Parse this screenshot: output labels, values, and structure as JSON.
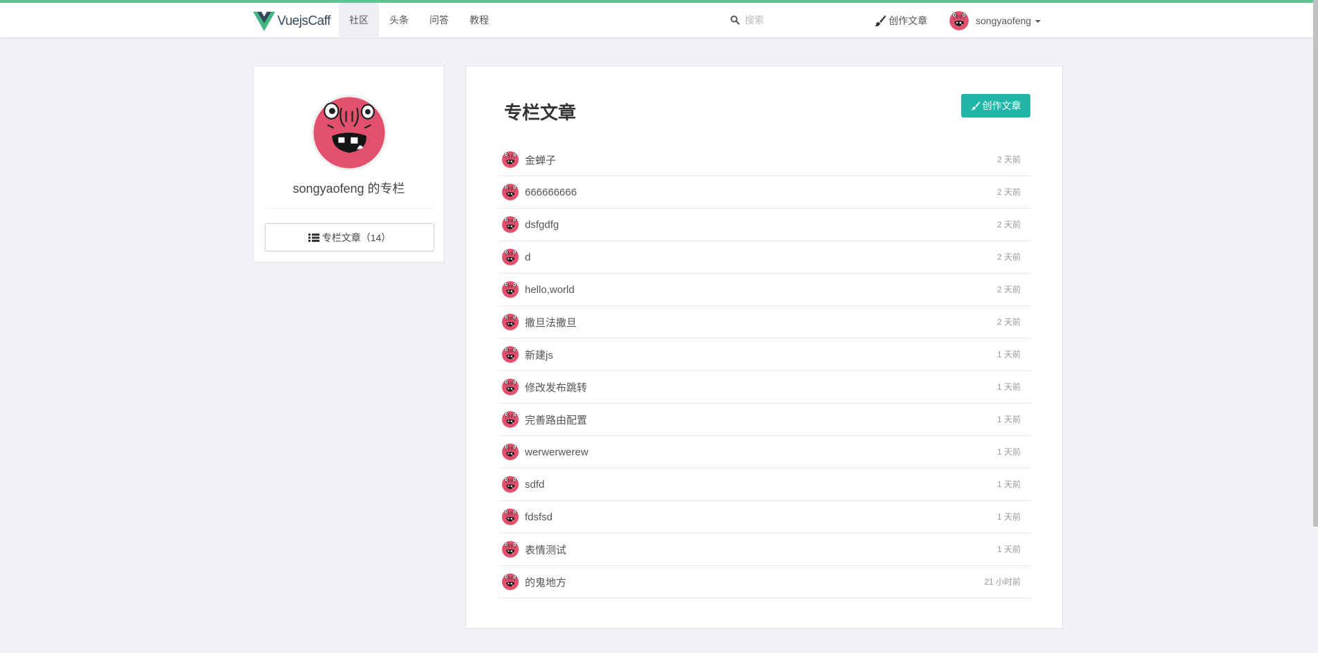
{
  "brand": {
    "name": "VuejsCaff",
    "logo_colors": {
      "outer": "#41b883",
      "inner": "#35495e"
    }
  },
  "colors": {
    "accent_line": "#5ec592",
    "button": "#21b6a8",
    "avatar": "#e3506e"
  },
  "nav": {
    "items": [
      {
        "label": "社区",
        "active": true
      },
      {
        "label": "头条",
        "active": false
      },
      {
        "label": "问答",
        "active": false
      },
      {
        "label": "教程",
        "active": false
      }
    ],
    "search_placeholder": "搜索",
    "create_label": "创作文章",
    "username": "songyaofeng"
  },
  "sidebar": {
    "title": "songyaofeng 的专栏",
    "articles_button": "专栏文章（14）"
  },
  "main": {
    "title": "专栏文章",
    "create_button": "创作文章",
    "articles": [
      {
        "title": "金蝉子",
        "time": "2 天前"
      },
      {
        "title": "666666666",
        "time": "2 天前"
      },
      {
        "title": "dsfgdfg",
        "time": "2 天前"
      },
      {
        "title": "d",
        "time": "2 天前"
      },
      {
        "title": "hello,world",
        "time": "2 天前"
      },
      {
        "title": "撒旦法撒旦",
        "time": "2 天前"
      },
      {
        "title": "新建js",
        "time": "1 天前"
      },
      {
        "title": "修改发布跳转",
        "time": "1 天前"
      },
      {
        "title": "完善路由配置",
        "time": "1 天前"
      },
      {
        "title": "werwerwerew",
        "time": "1 天前"
      },
      {
        "title": "sdfd",
        "time": "1 天前"
      },
      {
        "title": "fdsfsd",
        "time": "1 天前"
      },
      {
        "title": "表情测试",
        "time": "1 天前"
      },
      {
        "title": "的鬼地方",
        "time": "21 小时前"
      }
    ]
  }
}
